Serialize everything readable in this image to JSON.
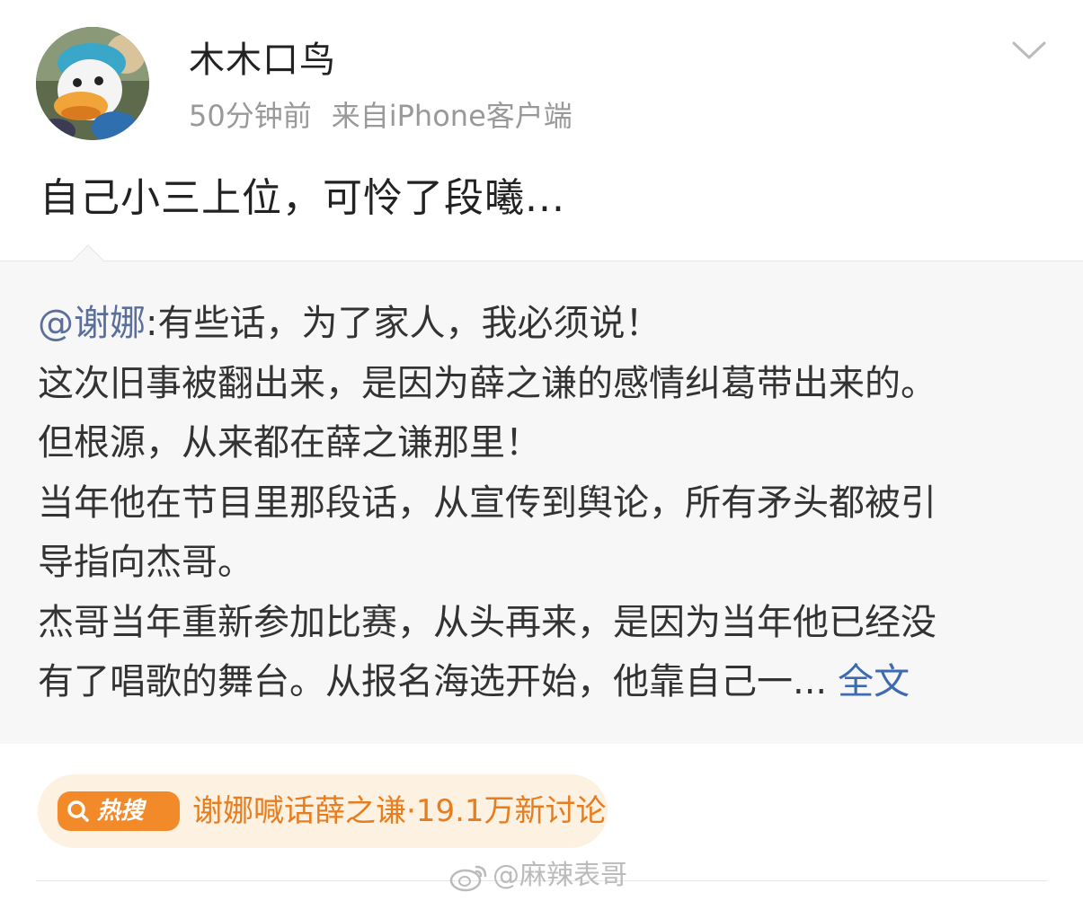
{
  "post": {
    "author": "木木口鸟",
    "time": "50分钟前",
    "source": "来自iPhone客户端",
    "text": "自己小三上位，可怜了段曦..."
  },
  "repost": {
    "mention": "@谢娜",
    "lines": [
      ":有些话，为了家人，我必须说！",
      "这次旧事被翻出来，是因为薛之谦的感情纠葛带出来的。",
      "但根源，从来都在薛之谦那里！",
      "当年他在节目里那段话，从宣传到舆论，所有矛头都被引",
      "导指向杰哥。",
      "杰哥当年重新参加比赛，从头再来，是因为当年他已经没",
      "有了唱歌的舞台。从报名海选开始，他靠自己一..."
    ],
    "full_text_link": "全文"
  },
  "hot_search": {
    "badge": "热搜",
    "text": "谢娜喊话薛之谦·19.1万新讨论"
  },
  "watermark": {
    "text": "@麻辣表哥"
  },
  "icons": {
    "more": "chevron-down-icon",
    "avatar": "donald-duck-avatar",
    "hot": "search-icon",
    "watermark": "weibo-logo-icon"
  },
  "colors": {
    "link": "#3d6ab0",
    "mention": "#5b6f99",
    "hot_accent": "#f38a2a",
    "hot_background": "#fdf1e2",
    "repost_background": "#f7f7f7"
  }
}
